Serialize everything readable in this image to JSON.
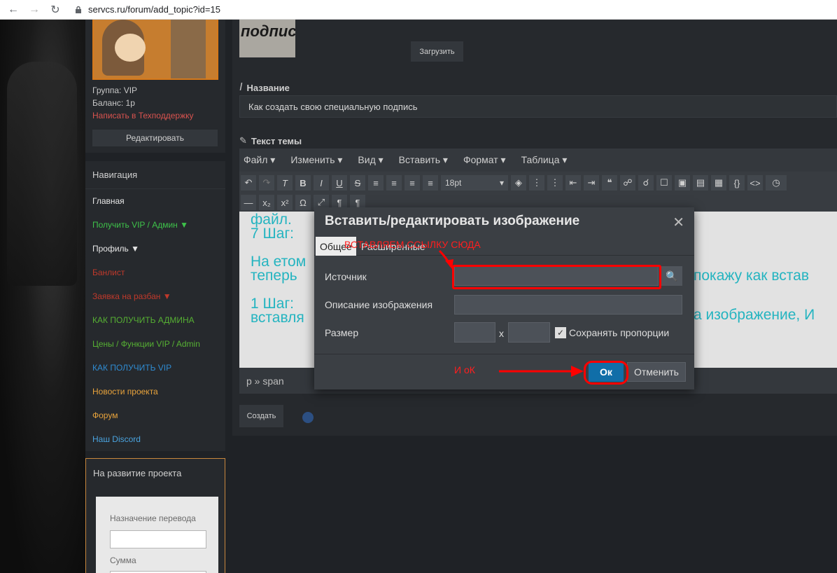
{
  "browser": {
    "url": "servcs.ru/forum/add_topic?id=15",
    "back_icon": "arrow-left-icon",
    "forward_icon": "arrow-right-icon",
    "reload_icon": "reload-icon",
    "lock_icon": "lock-icon"
  },
  "profile": {
    "group": "Группа: VIP",
    "balance": "Баланс: 1р",
    "support_link": "Написать в Техподдержку",
    "edit_button": "Редактировать"
  },
  "navigation": {
    "title": "Навигация",
    "items": [
      {
        "label": "Главная",
        "color": "#e6e6e6"
      },
      {
        "label": "Получить VIP / Админ ▼",
        "color": "#3ec24a"
      },
      {
        "label": "Профиль ▼",
        "color": "#e6e6e6"
      },
      {
        "label": "Банлист",
        "color": "#c0392b"
      },
      {
        "label": "Заявка на разбан ▼",
        "color": "#c0392b"
      },
      {
        "label": "КАК ПОЛУЧИТЬ АДМИНА",
        "color": "#56b033"
      },
      {
        "label": "Цены / Функции VIP / Admin",
        "color": "#56b033"
      },
      {
        "label": "КАК ПОЛУЧИТЬ VIP",
        "color": "#2f8bd1"
      },
      {
        "label": "Новости проекта",
        "color": "#e8a33c"
      },
      {
        "label": "Форум",
        "color": "#e8a33c"
      },
      {
        "label": "Наш Discord",
        "color": "#4aa3df"
      }
    ]
  },
  "donate": {
    "title": "На развитие проекта",
    "purpose_label": "Назначение перевода",
    "amount_label": "Сумма"
  },
  "topic_form": {
    "upload_button": "Загрузить",
    "name_label": "Название",
    "name_value": "Как создать свою специальную подпись",
    "text_label": "Текст темы",
    "create_button": "Создать"
  },
  "editor": {
    "menu": [
      "Файл ▾",
      "Изменить ▾",
      "Вид ▾",
      "Вставить ▾",
      "Формат ▾",
      "Таблица ▾"
    ],
    "font_size": "18pt",
    "content_lines": [
      "файл.",
      "7 Шаг:",
      "",
      "На етом",
      "теперь",
      "",
      "1 Шаг:",
      "вставля"
    ],
    "right_lines": [
      "покажу как встав",
      "а изображение, И"
    ],
    "statusbar": "p » span"
  },
  "dialog": {
    "title": "Вставить/редактировать изображение",
    "close": "✕",
    "tabs": [
      "Общее",
      "Расширенные"
    ],
    "source_label": "Источник",
    "description_label": "Описание изображения",
    "size_label": "Размер",
    "size_sep": "x",
    "keep_ratio": "Сохранять пропорции",
    "ok_button": "Ок",
    "cancel_button": "Отменить"
  },
  "annotations": {
    "paste_link": "ВСТАВЛЯЕМ ССЫЛКУ СЮДА",
    "and_ok": "И оК"
  }
}
